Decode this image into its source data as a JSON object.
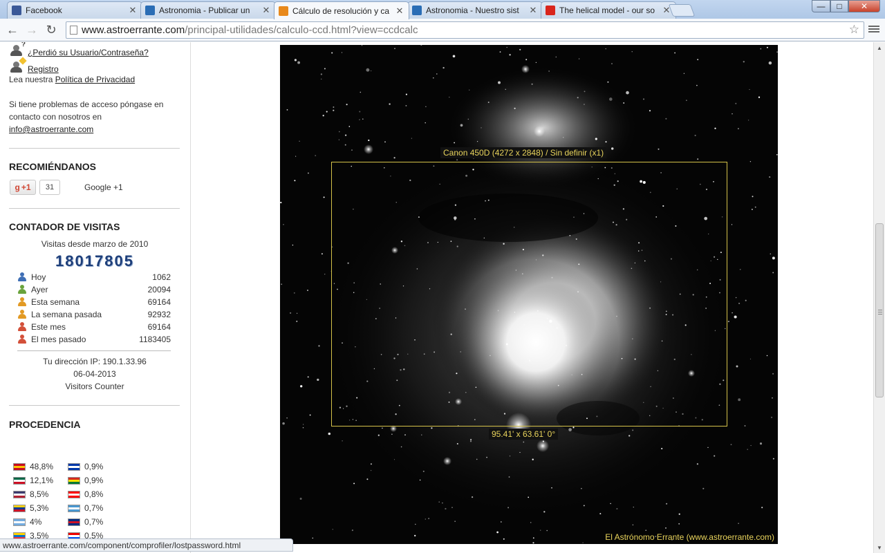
{
  "browser": {
    "tabs": [
      {
        "title": "Facebook",
        "favicon": "facebook-icon",
        "color": "#3b5998",
        "active": false
      },
      {
        "title": "Astronomia - Publicar un",
        "favicon": "espacio-icon",
        "color": "#2a6db5",
        "active": false
      },
      {
        "title": "Cálculo de resolución y ca",
        "favicon": "astroerrante-icon",
        "color": "#e8891c",
        "active": true
      },
      {
        "title": "Astronomia - Nuestro sist",
        "favicon": "espacio-icon",
        "color": "#2a6db5",
        "active": false
      },
      {
        "title": "The helical model - our so",
        "favicon": "youtube-icon",
        "color": "#d9251d",
        "active": false
      }
    ],
    "url_host": "www.astroerrante.com",
    "url_path": "/principal-utilidades/calculo-ccd.html?view=ccdcalc",
    "status_url": "www.astroerrante.com/component/comprofiler/lostpassword.html"
  },
  "sidebar": {
    "lost_password": "¿Perdió su Usuario/Contraseña?",
    "register": "Registro",
    "privacy_prefix": "Lea nuestra",
    "privacy_link": "Política de Privacidad",
    "access_help": "Si tiene problemas de acceso póngase en contacto con nosotros en",
    "email": "info@astroerrante.com",
    "recommend": {
      "heading": "RECOMIÉNDANOS",
      "button_label": "+1",
      "count": "31",
      "label": "Google +1"
    },
    "counter": {
      "heading": "CONTADOR DE VISITAS",
      "since": "Visitas desde marzo de 2010",
      "total": "18017805",
      "rows": [
        {
          "label": "Hoy",
          "value": "1062",
          "color": "#3f6fb5"
        },
        {
          "label": "Ayer",
          "value": "20094",
          "color": "#6aa33c"
        },
        {
          "label": "Esta semana",
          "value": "69164",
          "color": "#e29a24"
        },
        {
          "label": "La semana pasada",
          "value": "92932",
          "color": "#e29a24"
        },
        {
          "label": "Este mes",
          "value": "69164",
          "color": "#d3503a"
        },
        {
          "label": "El mes pasado",
          "value": "1183405",
          "color": "#d3503a"
        }
      ],
      "ip": "Tu dirección IP: 190.1.33.96",
      "date": "06-04-2013",
      "footer": "Visitors Counter"
    },
    "origin": {
      "heading": "PROCEDENCIA",
      "left": [
        {
          "pct": "48,8%",
          "flag": [
            "#c60b1e",
            "#ffc400",
            "#c60b1e"
          ]
        },
        {
          "pct": "12,1%",
          "flag": [
            "#006847",
            "#ffffff",
            "#ce1126"
          ]
        },
        {
          "pct": "8,5%",
          "flag": [
            "#3c3b6e",
            "#ffffff",
            "#b22234"
          ]
        },
        {
          "pct": "5,3%",
          "flag": [
            "#fcd116",
            "#003893",
            "#ce1126"
          ]
        },
        {
          "pct": "4%",
          "flag": [
            "#74acdf",
            "#ffffff",
            "#74acdf"
          ]
        },
        {
          "pct": "3,5%",
          "flag": [
            "#ffd100",
            "#0072ce",
            "#ef3340"
          ]
        }
      ],
      "right": [
        {
          "pct": "0,9%",
          "flag": [
            "#0038a8",
            "#ffffff",
            "#0038a8"
          ]
        },
        {
          "pct": "0,9%",
          "flag": [
            "#d52b1e",
            "#f9e300",
            "#007934"
          ]
        },
        {
          "pct": "0,8%",
          "flag": [
            "#ff0000",
            "#ffffff",
            "#ff0000"
          ]
        },
        {
          "pct": "0,7%",
          "flag": [
            "#4997d0",
            "#ffffff",
            "#4997d0"
          ]
        },
        {
          "pct": "0,7%",
          "flag": [
            "#002b7f",
            "#ce1126",
            "#002b7f"
          ]
        },
        {
          "pct": "0,5%",
          "flag": [
            "#ed0000",
            "#ffffff",
            "#0050f0"
          ]
        }
      ]
    }
  },
  "main": {
    "fov_title": "Canon 450D (4272 x 2848) / Sin definir (x1)",
    "fov_size": "95.41' x 63.61'   0°",
    "credit": "El Astrónomo Errante (www.astroerrante.com)"
  }
}
